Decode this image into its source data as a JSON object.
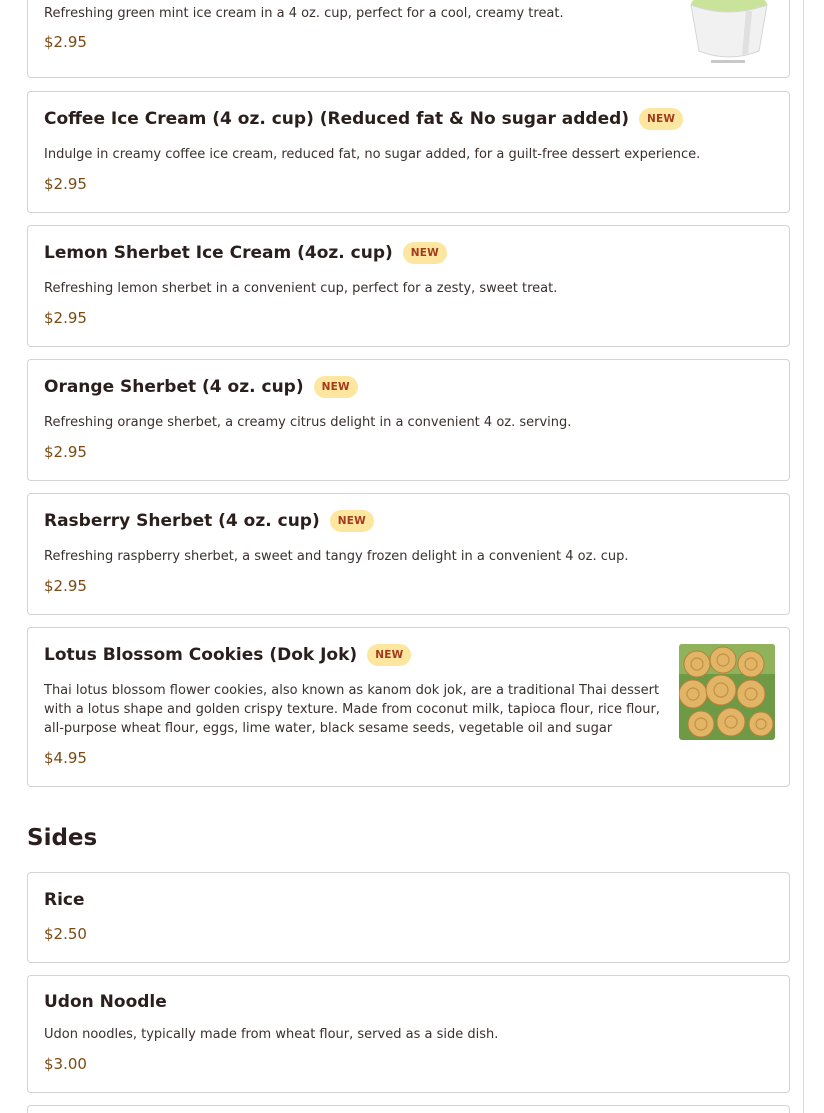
{
  "menu": {
    "badge_label": "NEW",
    "items": [
      {
        "description": "Refreshing green mint ice cream in a 4 oz. cup, perfect for a cool, creamy treat.",
        "price": "$2.95",
        "image_icon": "mint-ice-cream-cup-photo"
      },
      {
        "title": "Coffee Ice Cream (4 oz. cup) (Reduced fat & No sugar added)",
        "badge": "NEW",
        "description": "Indulge in creamy coffee ice cream, reduced fat, no sugar added, for a guilt-free dessert experience.",
        "price": "$2.95"
      },
      {
        "title": "Lemon Sherbet Ice Cream (4oz. cup)",
        "badge": "NEW",
        "description": "Refreshing lemon sherbet in a convenient cup, perfect for a zesty, sweet treat.",
        "price": "$2.95"
      },
      {
        "title": "Orange Sherbet (4 oz. cup)",
        "badge": "NEW",
        "description": "Refreshing orange sherbet, a creamy citrus delight in a convenient 4 oz. serving.",
        "price": "$2.95"
      },
      {
        "title": "Rasberry Sherbet (4 oz. cup)",
        "badge": "NEW",
        "description": "Refreshing raspberry sherbet, a sweet and tangy frozen delight in a convenient 4 oz. cup.",
        "price": "$2.95"
      },
      {
        "title": "Lotus Blossom Cookies (Dok Jok)",
        "badge": "NEW",
        "description": "Thai lotus blossom flower cookies, also known as kanom dok jok, are a traditional Thai dessert with a lotus shape and golden crispy texture. Made from coconut milk, tapioca flour, rice flour, all-purpose wheat flour, eggs, lime water, black sesame seeds, vegetable oil and sugar",
        "price": "$4.95",
        "image_icon": "lotus-cookies-photo"
      }
    ]
  },
  "sides": {
    "heading": "Sides",
    "items": [
      {
        "title": "Rice",
        "price": "$2.50"
      },
      {
        "title": "Udon Noodle",
        "description": "Udon noodles, typically made from wheat flour, served as a side dish.",
        "price": "$3.00"
      }
    ]
  },
  "colors": {
    "badge_bg": "#fde7a0",
    "badge_text": "#a43a1d",
    "price": "#7a4b13",
    "card_border": "#d4d4d4"
  }
}
